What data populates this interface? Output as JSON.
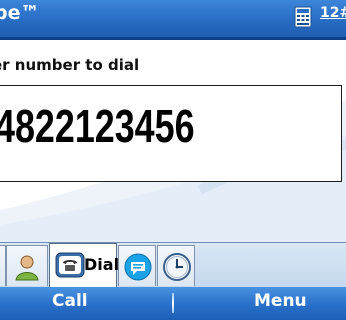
{
  "title_bar": {
    "app_title": "pe™",
    "input_mode_label": "12#",
    "input_mode_icon": "keyboard-icon"
  },
  "dial": {
    "prompt": "er number to dial",
    "number": "4822123456"
  },
  "tabs": [
    {
      "icon": "contacts-icon",
      "label": ""
    },
    {
      "icon": "phone-icon",
      "label": "Dial"
    },
    {
      "icon": "chat-icon",
      "label": ""
    },
    {
      "icon": "clock-icon",
      "label": ""
    }
  ],
  "softkeys": {
    "left": "Call",
    "right": "Menu"
  },
  "colors": {
    "title_bar": "#2a6fc6",
    "softkey_bar": "#2a72cc",
    "tab_strip": "#c4d8ee"
  }
}
